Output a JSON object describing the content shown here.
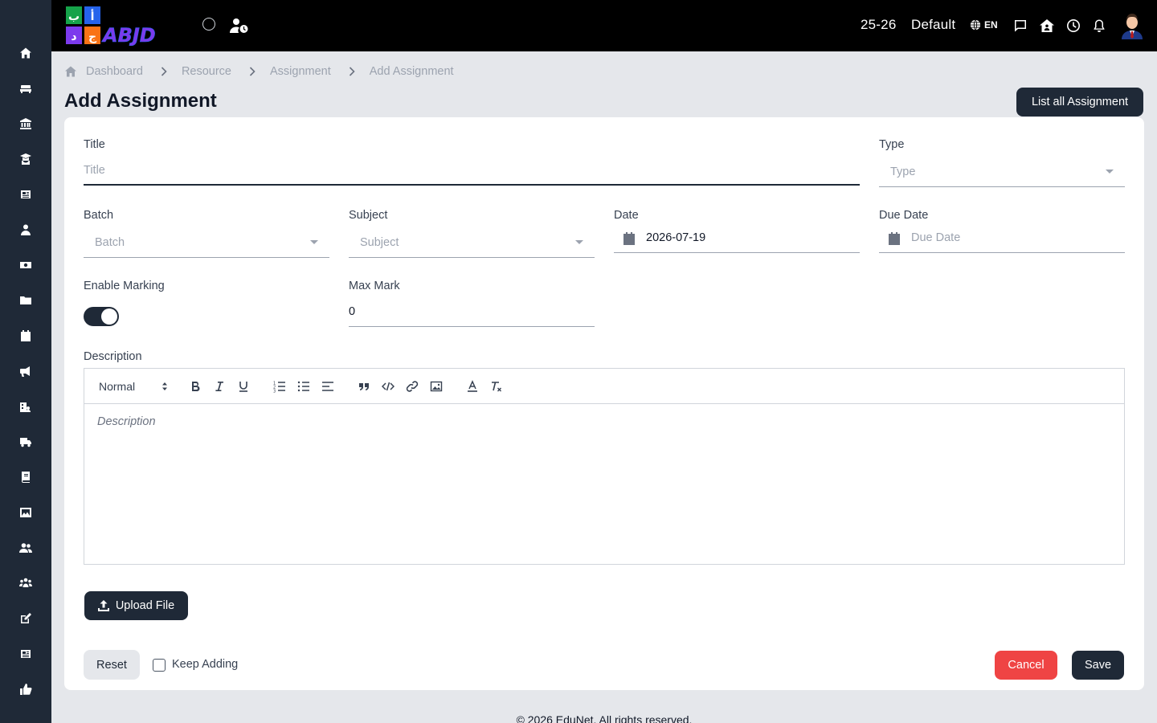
{
  "sidebar": {
    "items": [
      {
        "icon": "home-icon"
      },
      {
        "icon": "sofa-icon"
      },
      {
        "icon": "institution-icon"
      },
      {
        "icon": "graduate-icon"
      },
      {
        "icon": "newspaper-icon"
      },
      {
        "icon": "user-tie-icon"
      },
      {
        "icon": "money-bill-icon"
      },
      {
        "icon": "folder-icon"
      },
      {
        "icon": "calendar-icon"
      },
      {
        "icon": "megaphone-icon"
      },
      {
        "icon": "building-user-icon"
      },
      {
        "icon": "truck-icon"
      },
      {
        "icon": "book-icon"
      },
      {
        "icon": "image-icon"
      },
      {
        "icon": "users-icon"
      },
      {
        "icon": "people-group-icon"
      },
      {
        "icon": "edit-icon"
      },
      {
        "icon": "newspaper-alt-icon"
      },
      {
        "icon": "thumbs-up-icon"
      }
    ]
  },
  "header": {
    "logo_text": "ABJD",
    "session": "25-26",
    "profile": "Default",
    "language": "EN"
  },
  "breadcrumb": [
    "Dashboard",
    "Resource",
    "Assignment",
    "Add Assignment"
  ],
  "page": {
    "title": "Add Assignment",
    "list_button": "List all Assignment"
  },
  "form": {
    "title": {
      "label": "Title",
      "placeholder": "Title",
      "value": ""
    },
    "type": {
      "label": "Type",
      "placeholder": "Type"
    },
    "batch": {
      "label": "Batch",
      "placeholder": "Batch"
    },
    "subject": {
      "label": "Subject",
      "placeholder": "Subject"
    },
    "date": {
      "label": "Date",
      "value": "2026-07-19"
    },
    "due_date": {
      "label": "Due Date",
      "placeholder": "Due Date"
    },
    "enable_marking": {
      "label": "Enable Marking",
      "checked": true
    },
    "max_mark": {
      "label": "Max Mark",
      "value": "0"
    },
    "description": {
      "label": "Description",
      "placeholder": "Description",
      "heading_select": "Normal"
    },
    "upload_button": "Upload File",
    "reset_button": "Reset",
    "keep_adding": "Keep Adding",
    "cancel_button": "Cancel",
    "save_button": "Save"
  },
  "colors": {
    "primary": "#1f2937",
    "danger": "#ef4444",
    "page_bg": "#e5e7eb"
  },
  "footer": "© 2026 EduNet. All rights reserved."
}
